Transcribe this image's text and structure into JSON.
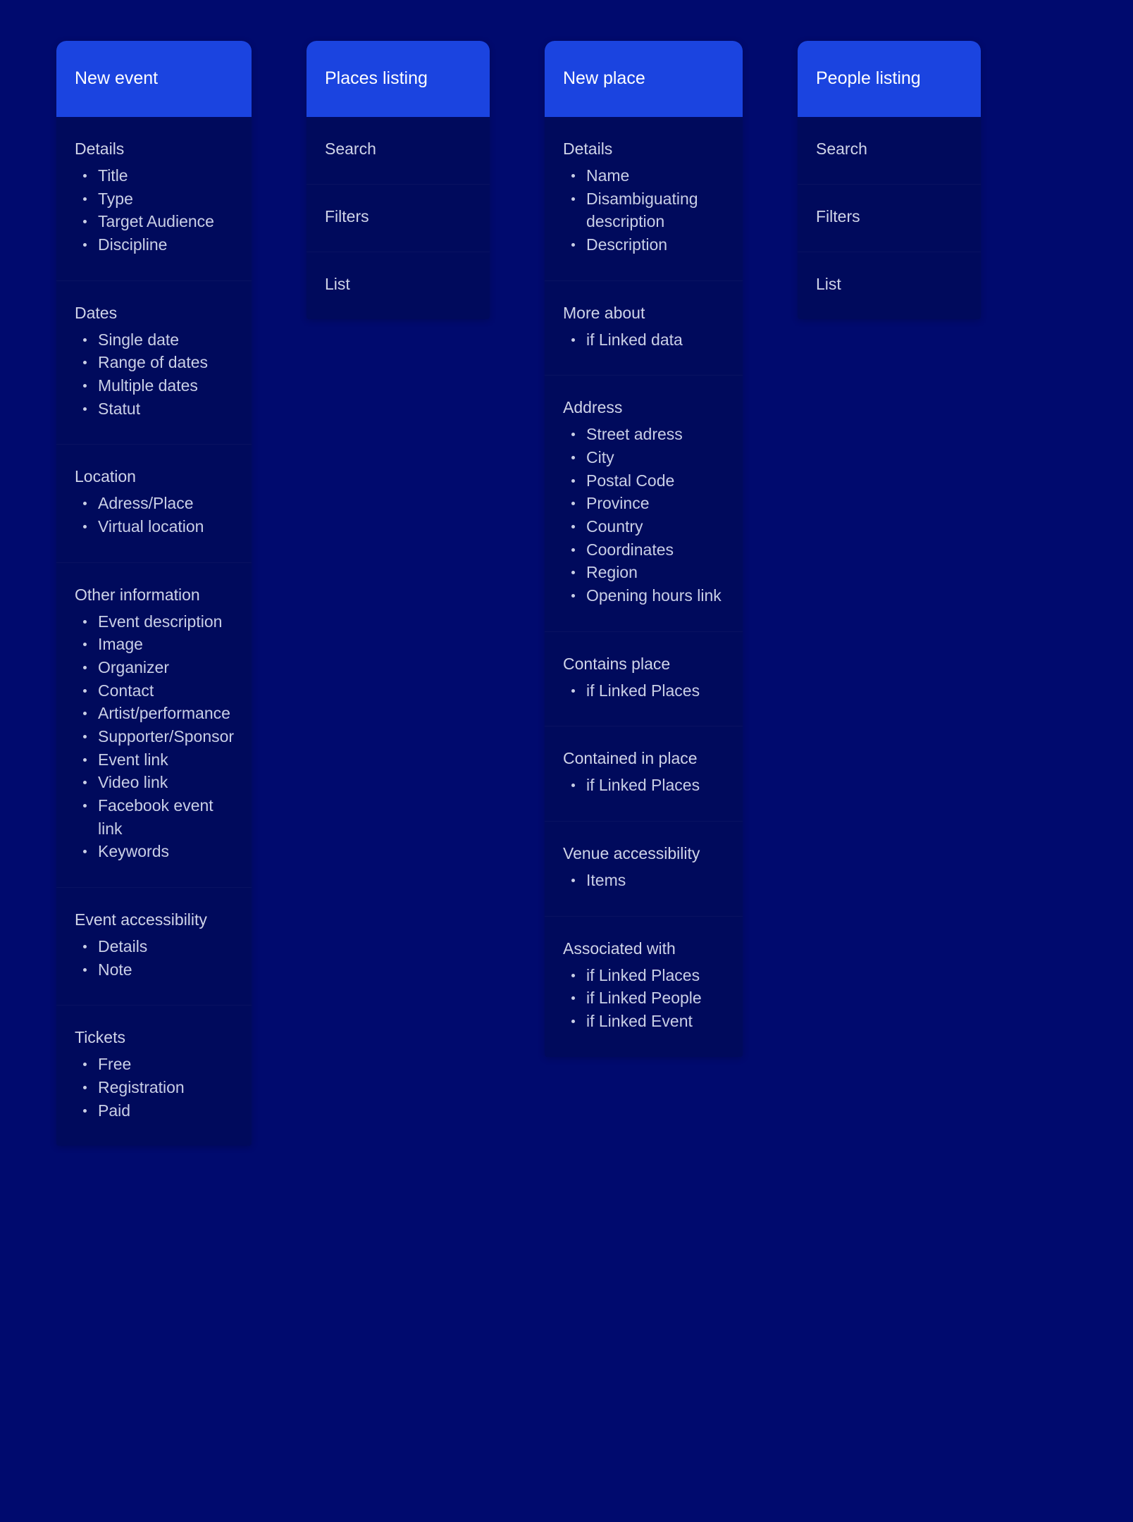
{
  "page": {
    "background_color": "#000a6e",
    "card_body_color": "#000a5c",
    "card_header_color": "#1b44e0",
    "text_color": "#c9cfe6"
  },
  "cards": [
    {
      "id": "new-event",
      "title": "New event",
      "kind": "sections",
      "sections": [
        {
          "title": "Details",
          "items": [
            "Title",
            "Type",
            "Target Audience",
            "Discipline"
          ]
        },
        {
          "title": "Dates",
          "items": [
            "Single date",
            "Range of dates",
            "Multiple dates",
            "Statut"
          ]
        },
        {
          "title": "Location",
          "items": [
            "Adress/Place",
            "Virtual location"
          ]
        },
        {
          "title": "Other information",
          "items": [
            "Event description",
            "Image",
            "Organizer",
            "Contact",
            "Artist/performance",
            "Supporter/Sponsor",
            "Event link",
            "Video link",
            "Facebook event link",
            "Keywords"
          ]
        },
        {
          "title": "Event accessibility",
          "items": [
            "Details",
            "Note"
          ]
        },
        {
          "title": "Tickets",
          "items": [
            "Free",
            "Registration",
            "Paid"
          ]
        }
      ]
    },
    {
      "id": "places-listing",
      "title": "Places listing",
      "kind": "menu",
      "menu_items": [
        "Search",
        "Filters",
        "List"
      ]
    },
    {
      "id": "new-place",
      "title": "New place",
      "kind": "sections",
      "sections": [
        {
          "title": "Details",
          "items": [
            "Name",
            "Disambiguating description",
            "Description"
          ]
        },
        {
          "title": "More about",
          "items": [
            "if Linked data"
          ]
        },
        {
          "title": "Address",
          "items": [
            "Street adress",
            "City",
            "Postal Code",
            "Province",
            "Country",
            "Coordinates",
            "Region",
            "Opening hours link"
          ]
        },
        {
          "title": "Contains place",
          "items": [
            "if Linked Places"
          ]
        },
        {
          "title": "Contained in place",
          "items": [
            "if Linked Places"
          ]
        },
        {
          "title": "Venue accessibility",
          "items": [
            "Items"
          ]
        },
        {
          "title": "Associated with",
          "items": [
            "if Linked Places",
            "if Linked People",
            "if Linked Event"
          ]
        }
      ]
    },
    {
      "id": "people-listing",
      "title": "People listing",
      "kind": "menu",
      "menu_items": [
        "Search",
        "Filters",
        "List"
      ]
    }
  ]
}
